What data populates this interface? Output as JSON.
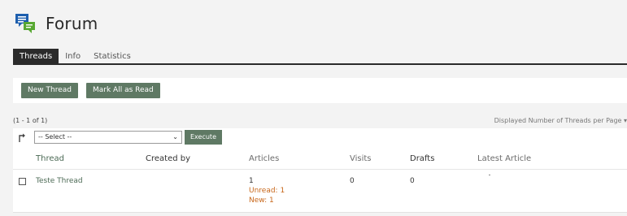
{
  "header": {
    "title": "Forum",
    "icon": "forum-chat-icon",
    "icon_color": "#1e5fae",
    "icon_accent": "#58a832"
  },
  "tabs": [
    {
      "label": "Threads",
      "active": true
    },
    {
      "label": "Info",
      "active": false
    },
    {
      "label": "Statistics",
      "active": false
    }
  ],
  "actions": {
    "new_thread": "New Thread",
    "mark_all_read": "Mark All as Read"
  },
  "listing": {
    "count": "(1 - 1 of 1)",
    "per_page": "Displayed Number of Threads per Page ▾"
  },
  "bulk": {
    "select_value": "-- Select --",
    "execute": "Execute"
  },
  "table": {
    "columns": [
      "Thread",
      "Created by",
      "Articles",
      "Visits",
      "Drafts",
      "Latest Article"
    ],
    "rows": [
      {
        "thread": "Teste Thread",
        "created_by": "",
        "articles": "1",
        "unread": "Unread: 1",
        "new": "New: 1",
        "visits": "0",
        "drafts": "0",
        "latest_article": ""
      }
    ]
  },
  "colors": {
    "button": "#5f7964",
    "link": "#4d6b56",
    "highlight": "#c8671a",
    "tab_active": "#2b2b2b"
  }
}
